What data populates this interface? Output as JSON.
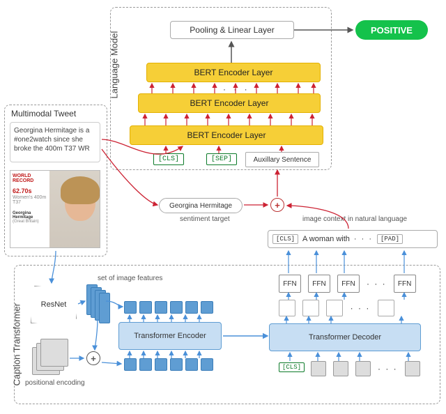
{
  "output_badge": "POSITIVE",
  "lm": {
    "title": "Language Model",
    "pooling": "Pooling & Linear Layer",
    "layer1": "BERT Encoder Layer",
    "layer2": "BERT Encoder Layer",
    "layer3": "BERT Encoder Layer",
    "ellipsis": "· · ·",
    "cls_tok": "[CLS]",
    "sep_tok": "[SEP]",
    "aux": "Auxillary Sentence"
  },
  "tweet": {
    "title": "Multimodal Tweet",
    "text": "Georgina Hermitage is a #one2watch since she broke the 400m T37 WR",
    "img_banner": "WORLD RECORD",
    "img_time": "62.70s",
    "img_sub1": "Women's 400m T37",
    "img_sub2": "Georgina Hermitage",
    "img_sub3": "(Great Britain)"
  },
  "mid": {
    "target_name": "Georgina Hermitage",
    "target_label": "sentiment target",
    "plus": "+",
    "image_context_label": "image context in natural language",
    "caption_cls": "[CLS]",
    "caption_text": "A woman with",
    "caption_dots": "· · ·",
    "caption_pad": "[PAD]"
  },
  "ct": {
    "title": "Caption Transformer",
    "resnet": "ResNet",
    "pe": "positional encoding",
    "feat_label": "set of image features",
    "encoder": "Transformer Encoder",
    "decoder": "Transformer Decoder",
    "ffn": "FFN",
    "ffn2": "FFN",
    "ffn3": "FFN",
    "ffn4": "FFN",
    "cls": "[CLS]",
    "dots": "· · ·",
    "plus": "+"
  }
}
